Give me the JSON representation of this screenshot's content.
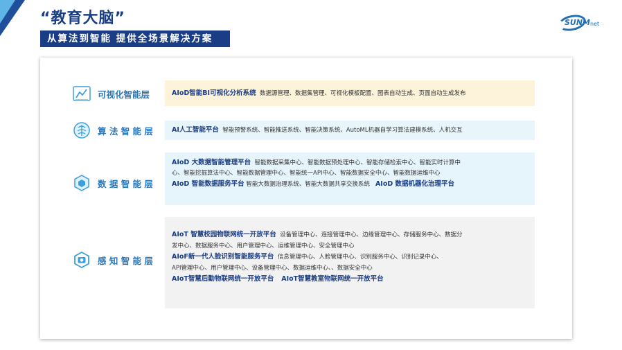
{
  "header": {
    "title": "“教育大脑”",
    "subtitle": "从算法到智能   提供全场景解决方案"
  },
  "logo": {
    "word": "SUNM",
    "suffix": "net"
  },
  "layers": [
    {
      "name": "可视化智能层",
      "icon": "bar-chart-icon"
    },
    {
      "name": "算 法 智 能 层",
      "icon": "brain-icon"
    },
    {
      "name": "数 据 智 能 层",
      "icon": "data-cube-icon"
    },
    {
      "name": "感 知 智 能 层",
      "icon": "camera-icon"
    }
  ],
  "visual": {
    "h1": "AIoD智能BI可视化分析系统",
    "t1": "数据源管理、数据集管理、可视化模板配置、图表自动生成、页面自动生成发布"
  },
  "algo": {
    "h1": "AI人工智能平台",
    "t1": "智能预警系统、智能推送系统、智能决策系统、AutoML机器自学习算法建模系统、人机交互"
  },
  "data": {
    "h1": "AIoD 大数据智能管理平台",
    "t1": "智能数据采集中心、智能数据预处理中心、智能存储检索中心、智能实时计算中",
    "t2": "心、智能挖掘算法中心、智能数据管理中心、智能统一API中心、智能数据安全中心、智能数据运维中心",
    "h2": "AIoD 智能数据服务平台",
    "t3": "智能大数据治理系统、智能大数据共享交换系统",
    "h3": "AIoD 数据机器化治理平台"
  },
  "sense": {
    "h1": "AIoT 智慧校园物联网统一开放平台",
    "t1": "设备管理中心、连接管理中心、边缘管理中心、存储服务中心、数据分",
    "t2": "发中心、数据服务中心、用户管理中心、运维管理中心、安全管理中心",
    "h2": "AIoF新一代人脸识别智能服务平台",
    "t3": "信息管理中心、人脸管理中心、识别服务中心、识别记录中心、",
    "t4": "API管理中心、用户管理中心、设备管理中心、数据运维中心、、数据安全中心",
    "h3": "AIoT智慧后勤物联网统一开放平台",
    "h4": "AIoT智慧教室物联网统一开放平台"
  }
}
